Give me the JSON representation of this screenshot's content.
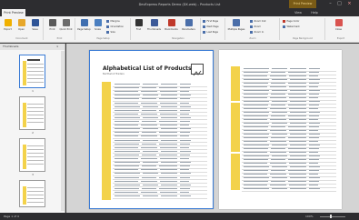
{
  "window": {
    "title": "DevExpress Reports Demo (DX.web) - Products List",
    "context_tab": "Print Preview",
    "minimize": "–",
    "maximize": "□",
    "close": "×"
  },
  "tabs": [
    {
      "label": "Print Preview",
      "active": true
    },
    {
      "label": "View"
    },
    {
      "label": "Help"
    }
  ],
  "ribbon": {
    "buttons": [
      {
        "label": "Export",
        "color": "#f0b000"
      },
      {
        "label": "Open",
        "color": "#e7a72a"
      },
      {
        "label": "Save",
        "color": "#2f5597"
      },
      {
        "label": "Print",
        "color": "#5a5a5a"
      },
      {
        "label": "Quick Print",
        "color": "#6b6b6b"
      },
      {
        "label": "Page Setup",
        "color": "#3f6fb0"
      },
      {
        "label": "Scale",
        "color": "#4b7fc0"
      },
      {
        "label": "Find",
        "color": "#333"
      },
      {
        "label": "Thumbnails",
        "color": "#3b5998"
      },
      {
        "label": "Bookmarks",
        "color": "#c0392b"
      },
      {
        "label": "Parameters",
        "color": "#4a6ea9"
      },
      {
        "label": "Multiple Pages",
        "color": "#4a6ea9"
      },
      {
        "label": "Close",
        "color": "#d9534f"
      }
    ],
    "small": [
      {
        "label": "Margins"
      },
      {
        "label": "Orientation"
      },
      {
        "label": "Size"
      },
      {
        "label": "First Page"
      },
      {
        "label": "Next Page"
      },
      {
        "label": "Last Page"
      },
      {
        "label": "Zoom Out"
      },
      {
        "label": "Zoom"
      },
      {
        "label": "Zoom In"
      },
      {
        "label": "Page Color"
      },
      {
        "label": "Watermark"
      }
    ],
    "groups": [
      "Document",
      "Print",
      "Page Setup",
      "Navigation",
      "Zoom",
      "Page Background",
      "Export"
    ]
  },
  "leftpane": {
    "header": "Thumbnails",
    "close": "×",
    "thumbs": [
      {
        "num": "1",
        "selected": true
      },
      {
        "num": "2"
      },
      {
        "num": "3"
      },
      {
        "num": "4"
      }
    ]
  },
  "document": {
    "title": "Alphabetical List of Products",
    "subtitle": "Northwind Traders"
  },
  "status": {
    "left": "Page 1 of 4",
    "zoom": "100%"
  }
}
